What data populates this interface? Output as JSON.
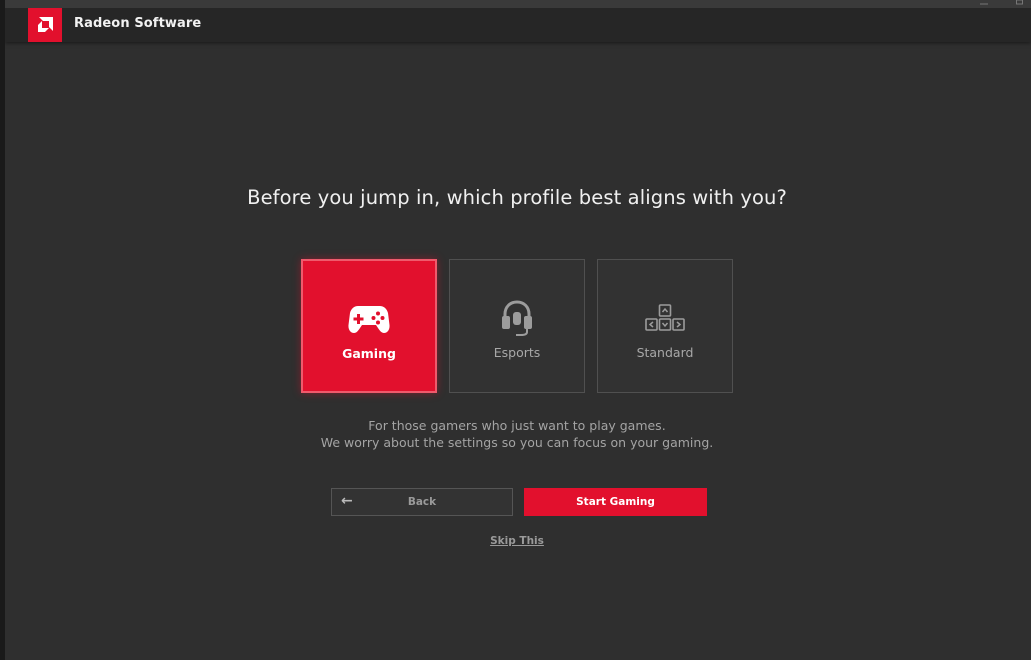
{
  "app": {
    "title": "Radeon Software",
    "brand_color": "#e2102d",
    "logo_icon": "amd-logo-icon"
  },
  "window_controls": {
    "minimize_icon": "minimize-icon",
    "maximize_icon": "maximize-icon"
  },
  "onboarding": {
    "heading": "Before you jump in, which profile best aligns with you?",
    "profiles": [
      {
        "label": "Gaming",
        "icon": "gamepad-icon",
        "selected": true
      },
      {
        "label": "Esports",
        "icon": "headset-icon",
        "selected": false
      },
      {
        "label": "Standard",
        "icon": "arrow-keys-icon",
        "selected": false
      }
    ],
    "description_line1": "For those gamers who just want to play games.",
    "description_line2": "We worry about the settings so you can focus on your gaming.",
    "back_label": "Back",
    "start_label": "Start Gaming",
    "skip_label": "Skip This"
  }
}
